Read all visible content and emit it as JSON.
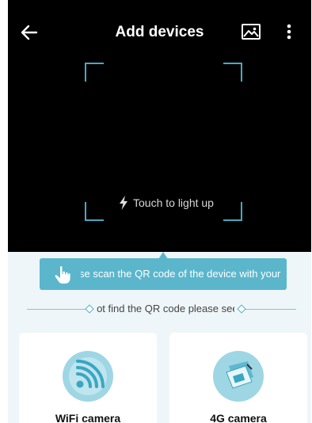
{
  "header": {
    "title": "Add devices",
    "back_icon": "arrow-left-icon",
    "gallery_icon": "image-icon",
    "more_icon": "more-vertical-icon"
  },
  "scanner": {
    "light_label": "Touch to light up",
    "light_icon": "flash-icon",
    "frame_color": "#47a9c1"
  },
  "tip": {
    "text": "Please scan the QR code of the device with your app",
    "icon": "hand-pointer-icon",
    "color": "#5bb6cc"
  },
  "hint": {
    "text": "If not find the QR code please see"
  },
  "devices": [
    {
      "label": "WiFi camera",
      "icon": "wifi-camera-icon"
    },
    {
      "label": "4G camera",
      "icon": "sim-card-icon"
    }
  ]
}
